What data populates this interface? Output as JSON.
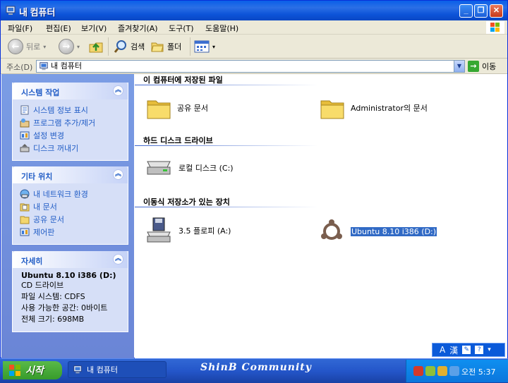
{
  "window": {
    "title": "내 컴퓨터",
    "controls": {
      "minimize": "_",
      "maximize": "❐",
      "close": "✕"
    }
  },
  "menu": [
    "파일(F)",
    "편집(E)",
    "보기(V)",
    "즐겨찾기(A)",
    "도구(T)",
    "도움말(H)"
  ],
  "toolbar": {
    "back": "뒤로",
    "search": "검색",
    "folders": "폴더"
  },
  "address": {
    "label": "주소(D)",
    "value": "내 컴퓨터",
    "go": "이동"
  },
  "sidebar": {
    "system_tasks": {
      "title": "시스템 작업",
      "items": [
        "시스템 정보 표시",
        "프로그램 추가/제거",
        "설정 변경",
        "디스크 꺼내기"
      ]
    },
    "other_places": {
      "title": "기타 위치",
      "items": [
        "내 네트워크 환경",
        "내 문서",
        "공유 문서",
        "제어판"
      ]
    },
    "details": {
      "title": "자세히",
      "name": "Ubuntu 8.10 i386 (D:)",
      "type": "CD 드라이브",
      "filesystem": "파일 시스템: CDFS",
      "free": "사용 가능한 공간: 0바이트",
      "total": "전체 크기: 698MB"
    }
  },
  "content": {
    "groups": [
      {
        "title": "이 컴퓨터에 저장된 파일",
        "items": [
          "공유 문서",
          "Administrator의 문서"
        ]
      },
      {
        "title": "하드 디스크 드라이브",
        "items": [
          "로컬 디스크 (C:)"
        ]
      },
      {
        "title": "이동식 저장소가 있는 장치",
        "items": [
          "3.5 플로피 (A:)",
          "Ubuntu 8.10 i386 (D:)"
        ]
      }
    ]
  },
  "taskbar": {
    "start": "시작",
    "task": "내 컴퓨터",
    "brand": "ShinB Community",
    "clock": "오전 5:37"
  },
  "langbar": {
    "mode": "A",
    "hanja": "漢"
  },
  "colors": {
    "title_blue": "#0a5fe8",
    "sidebar_blue": "#7b9de5",
    "task_link": "#215dc6",
    "selection": "#316ac5",
    "start_green": "#379b2b"
  }
}
